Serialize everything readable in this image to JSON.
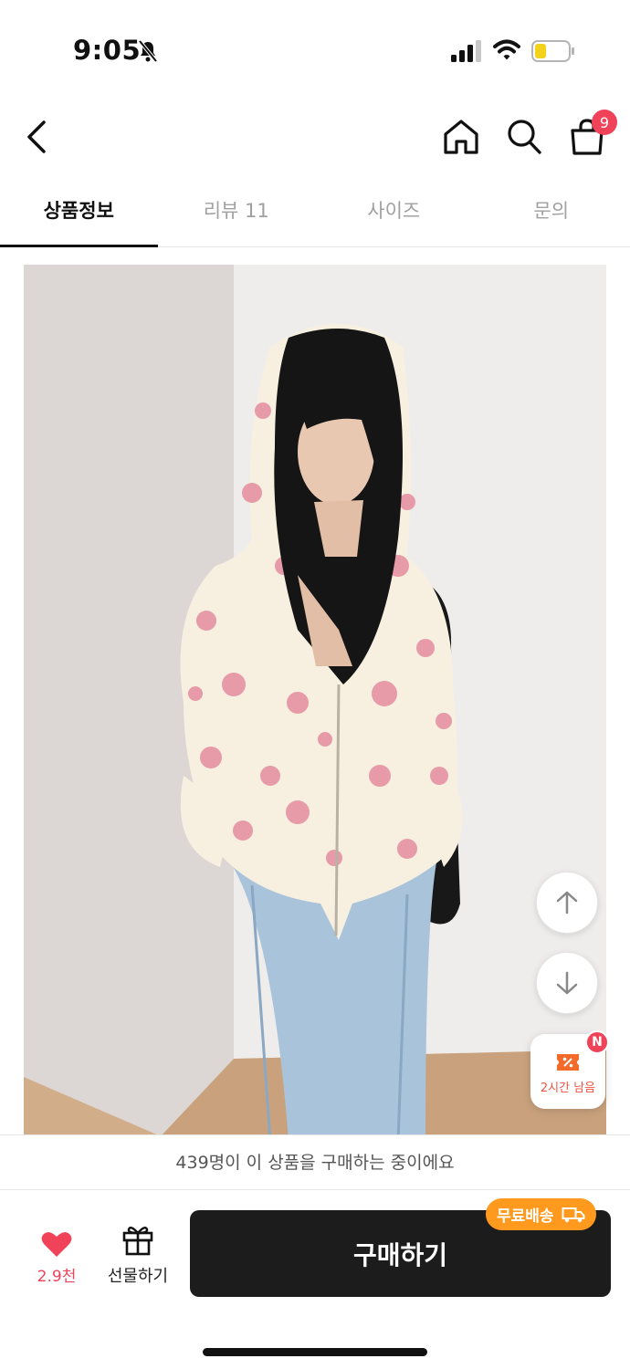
{
  "status_bar": {
    "time": "9:05",
    "icons": [
      "bell-slash-icon",
      "signal-icon",
      "wifi-icon",
      "battery-icon"
    ],
    "battery_color": "#f4d21c"
  },
  "nav": {
    "icons": [
      "back-icon",
      "home-icon",
      "search-icon",
      "bag-icon"
    ],
    "cart_badge": "9",
    "badge_color": "#f0435a"
  },
  "tabs": [
    {
      "label": "상품정보",
      "active": true
    },
    {
      "label": "리뷰 11",
      "active": false
    },
    {
      "label": "사이즈",
      "active": false
    },
    {
      "label": "문의",
      "active": false
    }
  ],
  "floating": {
    "scroll_up_icon": "arrow-up-icon",
    "scroll_down_icon": "arrow-down-icon",
    "coupon_text": "2시간 남음",
    "coupon_badge": "N",
    "coupon_color": "#f46a2a"
  },
  "buyers_notice": "439명이 이 상품을 구매하는 중이에요",
  "bottom": {
    "like_count": "2.9천",
    "gift_label": "선물하기",
    "buy_label": "구매하기",
    "free_shipping_label": "무료배송",
    "accent_color": "#ff9a1f"
  }
}
